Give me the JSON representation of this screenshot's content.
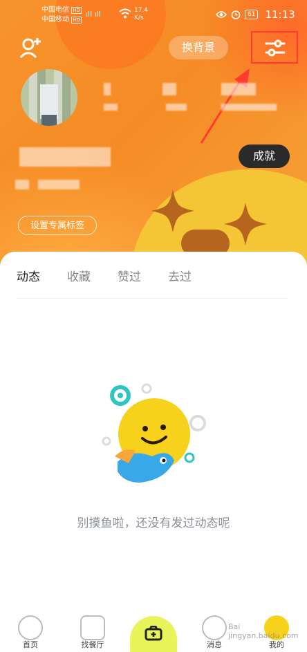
{
  "status_bar": {
    "carrier1": "中国电信",
    "carrier2": "中国移动",
    "network1": "HD",
    "network2": "HD",
    "signal": "ıll ıll",
    "speed_value": "17.4",
    "speed_unit": "K/s",
    "battery": "61",
    "time": "11:13"
  },
  "header": {
    "change_bg_label": "换背景",
    "achievements_label": "成就",
    "set_tag_label": "设置专属标签"
  },
  "tabs": [
    "动态",
    "收藏",
    "赞过",
    "去过"
  ],
  "empty_state": {
    "message": "别摸鱼啦，还没有发过动态呢"
  },
  "nav": {
    "home": "首页",
    "restaurants": "找餐厅",
    "messages": "消息",
    "mine": "我的"
  },
  "watermark": "Bai jingyan.baidu.com",
  "colors": {
    "header_orange": "#f7942c",
    "achievements_bg": "#2a2a2a",
    "camera_button": "#e9f35a",
    "highlight_red": "#ff3b30"
  }
}
